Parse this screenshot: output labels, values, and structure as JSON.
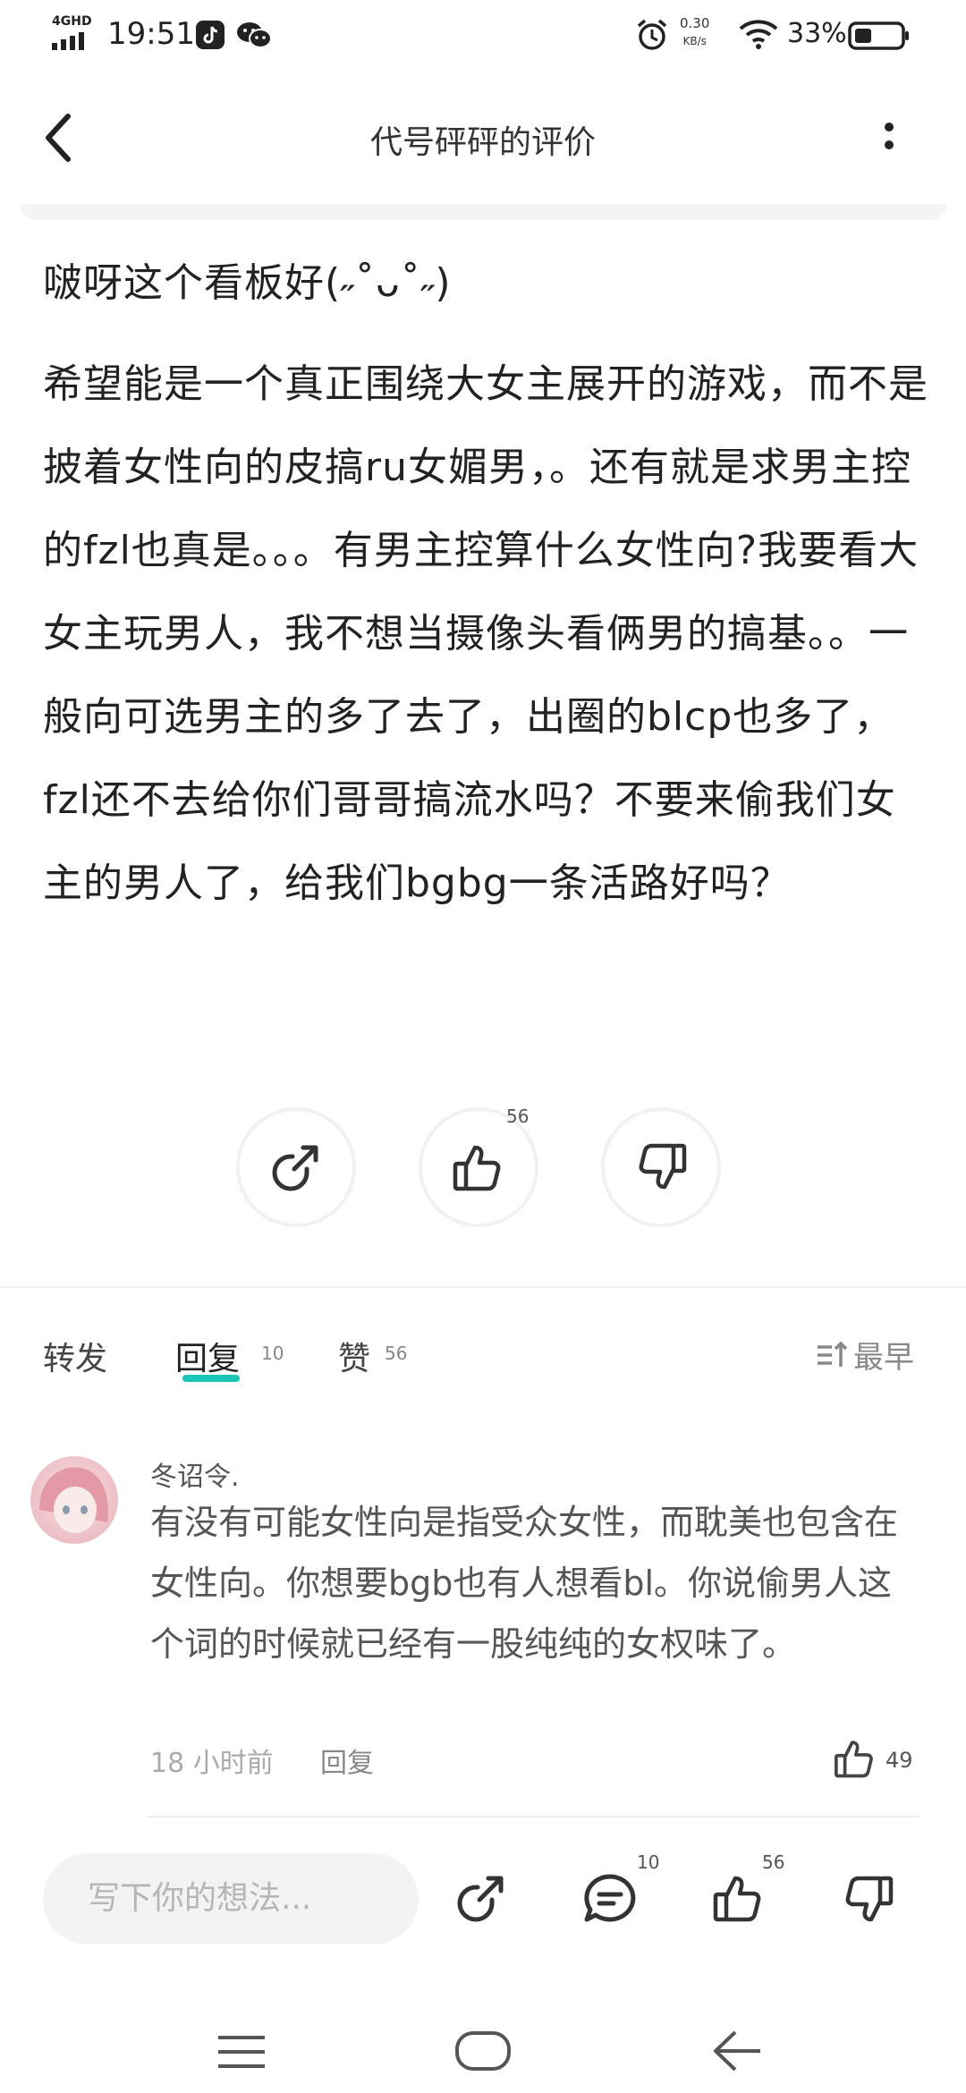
{
  "status_bar": {
    "network": "4GHD",
    "time": "19:51",
    "speed_value": "0.30",
    "speed_unit": "KB/s",
    "battery": "33%"
  },
  "header": {
    "title": "代号砰砰的评价"
  },
  "post": {
    "line1": "啵呀这个看板好(˶˚ᴗ˚˶)",
    "paragraph": "希望能是一个真正围绕大女主展开的游戏，而不是披着女性向的皮搞ru女媚男，。还有就是求男主控的fzl也真是。。。有男主控算什么女性向?我要看大女主玩男人，我不想当摄像头看俩男的搞基。。一般向可选男主的多了去了，出圈的blcp也多了，fzl还不去给你们哥哥搞流水吗？不要来偷我们女主的男人了，给我们bgbg一条活路好吗？"
  },
  "actions": {
    "like_count": "56"
  },
  "tabs": {
    "forward": "转发",
    "reply": "回复",
    "reply_count": "10",
    "like": "赞",
    "like_count": "56",
    "sort": "最早"
  },
  "comment": {
    "user": "冬诏令.",
    "text": "有没有可能女性向是指受众女性，而耽美也包含在女性向。你想要bgb也有人想看bl。你说偷男人这个词的时候就已经有一股纯纯的女权味了。",
    "time": "18 小时前",
    "reply": "回复",
    "likes": "49"
  },
  "bottom_bar": {
    "placeholder": "写下你的想法...",
    "comment_count": "10",
    "like_count": "56"
  },
  "colors": {
    "accent": "#1bc4b4",
    "input_bg": "#f2f3f5"
  }
}
